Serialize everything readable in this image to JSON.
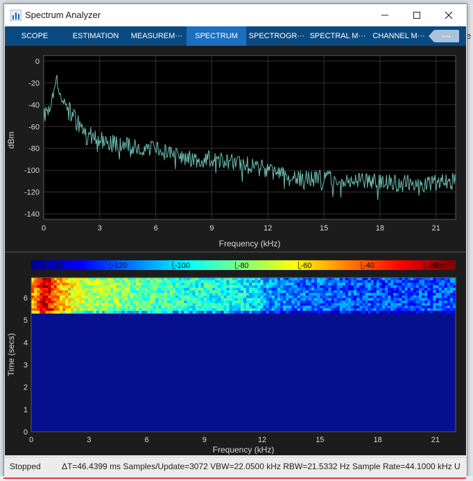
{
  "window": {
    "title": "Spectrum Analyzer",
    "minimize_icon": "minimize-icon",
    "maximize_icon": "maximize-icon",
    "close_icon": "close-icon"
  },
  "background": {
    "right_edge_text": "e"
  },
  "toolstrip": {
    "tabs": [
      {
        "label": "SCOPE",
        "active": false
      },
      {
        "label": "ESTIMATION",
        "active": false
      },
      {
        "label": "MEASUREM···",
        "active": false
      },
      {
        "label": "SPECTRUM",
        "active": true
      },
      {
        "label": "SPECTROGR···",
        "active": false
      },
      {
        "label": "SPECTRAL M···",
        "active": false
      },
      {
        "label": "CHANNEL M···",
        "active": false
      }
    ],
    "more_label": "···",
    "colors": {
      "bar": "#0b4a80",
      "active": "#1a6fc0"
    }
  },
  "spectrum": {
    "ylabel": "dBm",
    "xlabel": "Frequency (kHz)",
    "ylim": [
      -145,
      5
    ],
    "xlim": [
      0,
      22.05
    ],
    "yticks": [
      0,
      -20,
      -40,
      -60,
      -80,
      -100,
      -120,
      -140
    ],
    "xticks": [
      0,
      3,
      6,
      9,
      12,
      15,
      18,
      21
    ],
    "trace_color": "#6fbfb4"
  },
  "spectrogram": {
    "colorbar_labels": [
      "-140",
      "-120",
      "-100",
      "-80",
      "-60",
      "-40",
      "-20"
    ],
    "colorbar_unit": "dBm",
    "ylabel": "Time (secs)",
    "xlabel": "Frequency (kHz)",
    "yticks": [
      0,
      1,
      2,
      3,
      4,
      5,
      6
    ],
    "xticks": [
      0,
      3,
      6,
      9,
      12,
      15,
      18,
      21
    ],
    "fill_color": "#06108e"
  },
  "chart_data": [
    {
      "type": "line",
      "title": "",
      "xlabel": "Frequency (kHz)",
      "ylabel": "dBm",
      "xlim": [
        0,
        22.05
      ],
      "ylim": [
        -145,
        5
      ],
      "grid": true,
      "series": [
        {
          "x": [
            0,
            0.3,
            0.5,
            0.7,
            1,
            1.5,
            2,
            2.5,
            3,
            4,
            5,
            6,
            7,
            8,
            9,
            10,
            11,
            12,
            13,
            14,
            15,
            16,
            17,
            18,
            19,
            20,
            21,
            22
          ],
          "y": [
            -50,
            -42,
            -28,
            -18,
            -32,
            -50,
            -60,
            -68,
            -72,
            -76,
            -80,
            -82,
            -86,
            -90,
            -90,
            -93,
            -95,
            -100,
            -106,
            -108,
            -108,
            -110,
            -110,
            -110,
            -112,
            -112,
            -112,
            -110
          ]
        }
      ]
    },
    {
      "type": "heatmap",
      "xlabel": "Frequency (kHz)",
      "ylabel": "Time (secs)",
      "xlim": [
        0,
        22.05
      ],
      "ylim": [
        0,
        6.9
      ],
      "colorbar": {
        "min": -145,
        "max": -10,
        "unit": "dBm",
        "ticks": [
          -140,
          -120,
          -100,
          -80,
          -60,
          -40,
          -20
        ]
      }
    }
  ],
  "status": {
    "state": "Stopped",
    "info": "ΔT=46.4399 ms  Samples/Update=3072  VBW=22.0500 kHz  RBW=21.5332 Hz  Sample Rate=44.1000 kHz  U"
  }
}
